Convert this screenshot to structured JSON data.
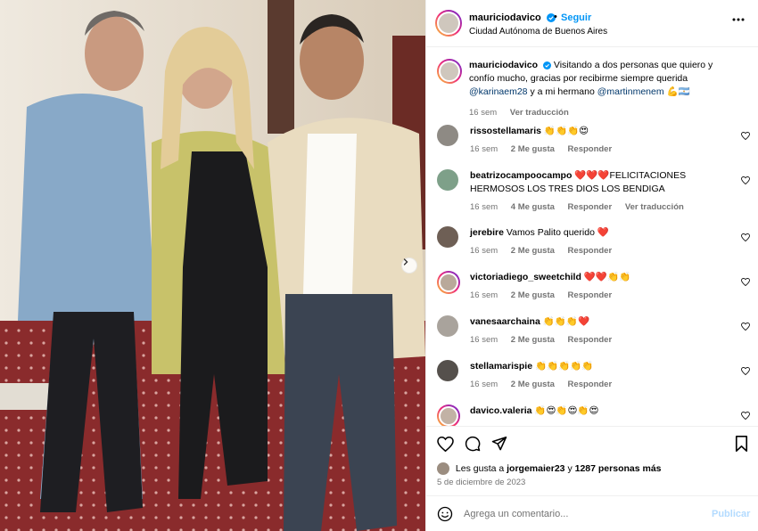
{
  "post": {
    "username": "mauriciodavico",
    "follow_label": "Seguir",
    "dot": "•",
    "location": "Ciudad Autónoma de Buenos Aires"
  },
  "caption": {
    "username": "mauriciodavico",
    "text": "Visitando a dos personas que quiero y confío mucho, gracias por recibirme siempre querida",
    "mention1": "@karinaem28",
    "middle": "y a mi hermano",
    "mention2": "@martinmenem",
    "emoji": "💪🇦🇷",
    "time": "16 sem",
    "translate": "Ver traducción"
  },
  "comments": [
    {
      "user": "rissostellamaris",
      "text": "👏👏👏😍",
      "time": "16 sem",
      "likes": "2 Me gusta",
      "reply": "Responder"
    },
    {
      "user": "beatrizocampoocampo",
      "text": "❤️❤️❤️FELICITACIONES HERMOSOS LOS TRES DIOS LOS BENDIGA",
      "time": "16 sem",
      "likes": "4 Me gusta",
      "reply": "Responder",
      "translate": "Ver traducción"
    },
    {
      "user": "jerebire",
      "text": "Vamos Palito querido ❤️",
      "time": "16 sem",
      "likes": "2 Me gusta",
      "reply": "Responder"
    },
    {
      "user": "victoriadiego_sweetchild",
      "text": "❤️❤️👏👏",
      "time": "16 sem",
      "likes": "2 Me gusta",
      "reply": "Responder"
    },
    {
      "user": "vanesaarchaina",
      "text": "👏👏👏❤️",
      "time": "16 sem",
      "likes": "2 Me gusta",
      "reply": "Responder"
    },
    {
      "user": "stellamarispie",
      "text": "👏👏👏👏👏",
      "time": "16 sem",
      "likes": "2 Me gusta",
      "reply": "Responder"
    },
    {
      "user": "davico.valeria",
      "text": "👏😍👏😍👏😍"
    }
  ],
  "footer": {
    "likes_prefix": "Les gusta a",
    "likes_user": "jorgemaier23",
    "likes_and": "y",
    "likes_count": "1287 personas más",
    "date": "5 de diciembre de 2023",
    "comment_placeholder": "Agrega un comentario...",
    "publish_label": "Publicar"
  },
  "colors": {
    "accent": "#0095f6",
    "mention": "#00376b",
    "muted": "#737373"
  },
  "icons": [
    "verified-icon",
    "more-icon",
    "heart-icon",
    "comment-icon",
    "share-icon",
    "bookmark-icon",
    "emoji-icon",
    "chevron-right-icon"
  ]
}
